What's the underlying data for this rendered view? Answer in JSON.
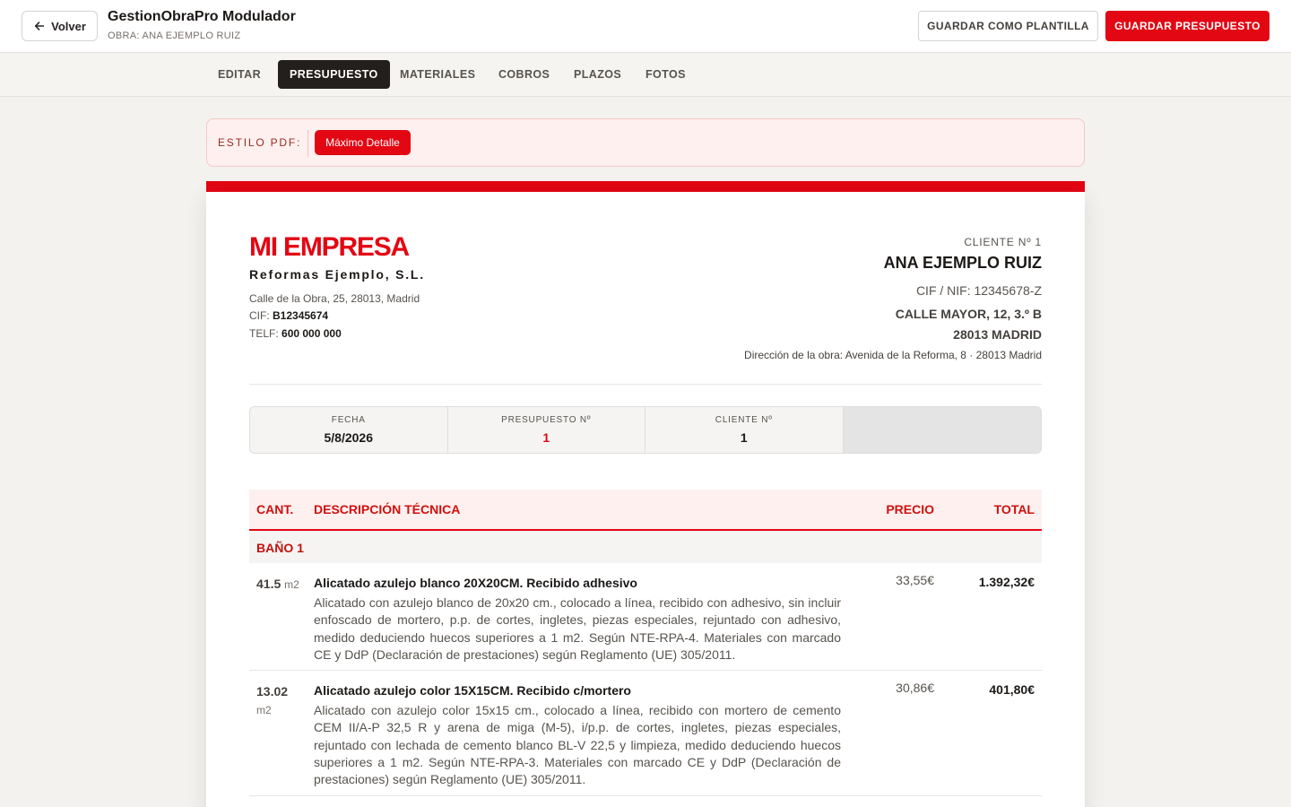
{
  "header": {
    "back_label": "Volver",
    "app_title": "GestionObraPro Modulador",
    "subtitle": "OBRA: ANA EJEMPLO RUIZ",
    "template_label": "GUARDAR COMO PLANTILLA",
    "save_label": "GUARDAR PRESUPUESTO"
  },
  "tabs": [
    {
      "label": "EDITAR"
    },
    {
      "label": "PRESUPUESTO"
    },
    {
      "label": "MATERIALES"
    },
    {
      "label": "COBROS"
    },
    {
      "label": "PLAZOS"
    },
    {
      "label": "FOTOS"
    }
  ],
  "style_bar": {
    "label": "ESTILO PDF:",
    "selected": "Máximo Detalle"
  },
  "company": {
    "name": "MI EMPRESA",
    "legal_name": "Reformas Ejemplo, S.L.",
    "address": "Calle de la Obra, 25, 28013, Madrid",
    "cif_label": "CIF:",
    "cif": "B12345674",
    "phone_label": "TELF:",
    "phone": "600 000 000"
  },
  "client": {
    "number_label": "CLIENTE Nº 1",
    "name": "ANA EJEMPLO RUIZ",
    "cif": "CIF / NIF: 12345678-Z",
    "address": "CALLE MAYOR, 12, 3.º B",
    "city": "28013 MADRID",
    "work_address": "Dirección de la obra: Avenida de la Reforma, 8 · 28013 Madrid"
  },
  "meta": {
    "date_label": "FECHA",
    "date": "5/8/2026",
    "budget_label": "PRESUPUESTO Nº",
    "budget_number": "1",
    "client_label": "CLIENTE Nº",
    "client_number": "1"
  },
  "table": {
    "headers": {
      "qty": "CANT.",
      "description": "DESCRIPCIÓN TÉCNICA",
      "price": "PRECIO",
      "total": "TOTAL"
    },
    "section": "BAÑO 1",
    "rows": [
      {
        "qty": "41.5",
        "unit": "m2",
        "title": "Alicatado azulejo blanco 20X20CM. Recibido adhesivo",
        "text": "Alicatado con azulejo blanco de 20x20 cm., colocado a línea, recibido con adhesivo, sin incluir enfoscado de mortero, p.p. de cortes, ingletes, piezas especiales, rejuntado con adhesivo, medido deduciendo huecos superiores a 1 m2. Según NTE-RPA-4. Materiales con marcado CE y DdP (Declaración de prestaciones) según Reglamento (UE) 305/2011.",
        "price": "33,55€",
        "total": "1.392,32€"
      },
      {
        "qty": "13.02",
        "unit": "m2",
        "title": "Alicatado azulejo color 15X15CM. Recibido c/mortero",
        "text": "Alicatado con azulejo color 15x15 cm., colocado a línea, recibido con mortero de cemento CEM II/A-P 32,5 R y arena de miga (M-5), i/p.p. de cortes, ingletes, piezas especiales, rejuntado con lechada de cemento blanco BL-V 22,5 y limpieza, medido deduciendo huecos superiores a 1 m2. Según NTE-RPA-3. Materiales con marcado CE y DdP (Declaración de prestaciones) según Reglamento (UE) 305/2011.",
        "price": "30,86€",
        "total": "401,80€"
      }
    ]
  },
  "colors": {
    "accent": "#e30613",
    "dark_tab": "#231f1c"
  }
}
